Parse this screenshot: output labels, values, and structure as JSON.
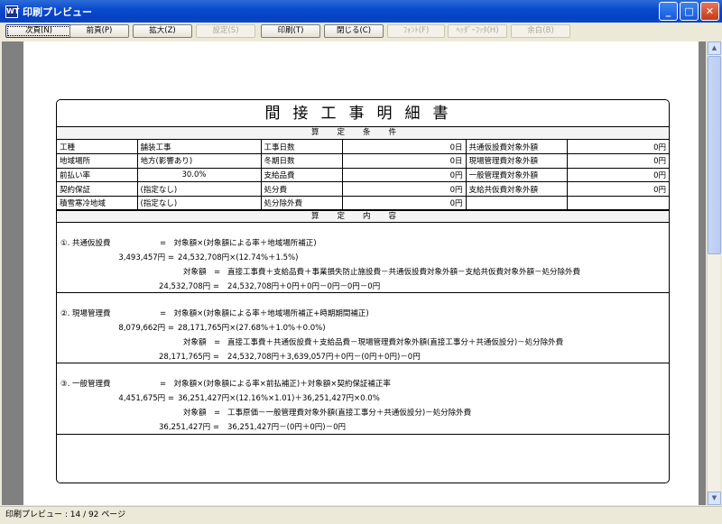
{
  "window": {
    "title": "印刷プレビュー",
    "app_icon": "WT"
  },
  "toolbar": {
    "next": "次頁(N)",
    "prev": "前頁(P)",
    "zoom": "拡大(Z)",
    "settings": "設定(S)",
    "print": "印刷(T)",
    "close": "閉じる(C)",
    "font": "ﾌｫﾝﾄ(F)",
    "header_footer": "ﾍｯﾀﾞｰﾌｯﾀ(H)",
    "margin": "余白(B)"
  },
  "status": "印刷プレビュー : 14 / 92 ページ",
  "doc": {
    "title": "間接工事明細書",
    "conditions_header": "算定条件",
    "contents_header": "算定内容",
    "conditions": [
      [
        "工種",
        "舗装工事",
        "工事日数",
        "0日",
        "共通仮設費対象外額",
        "0円"
      ],
      [
        "地域場所",
        "地方(影響あり)",
        "冬期日数",
        "0日",
        "現場管理費対象外額",
        "0円"
      ],
      [
        "前払い率",
        "30.0%",
        "支給品費",
        "0円",
        "一般管理費対象外額",
        "0円"
      ],
      [
        "契約保証",
        "(指定なし)",
        "処分費",
        "0円",
        "支給共仮費対象外額",
        "0円"
      ],
      [
        "積雪寒冷地域",
        "(指定なし)",
        "処分除外費",
        "0円",
        "",
        ""
      ]
    ],
    "calc": [
      {
        "label": "①. 共通仮設費",
        "amount": "3,493,457円 =",
        "f1": "=　対象額×(対象額による率＋地域場所補正)",
        "f2": "24,532,708円×(12.74%＋1.5%)",
        "t_label": "対象額　=",
        "t_formula": "直接工事費＋支給品費＋事業損失防止施設費－共通仮設費対象外額－支給共仮費対象外額－処分除外費",
        "t_amount": "24,532,708円 =",
        "t_values": "24,532,708円＋0円＋0円－0円－0円－0円"
      },
      {
        "label": "②. 現場管理費",
        "amount": "8,079,662円 =",
        "f1": "=　対象額×(対象額による率＋地域場所補正+時期期間補正)",
        "f2": "28,171,765円×(27.68%＋1.0%＋0.0%)",
        "t_label": "対象額　=",
        "t_formula": "直接工事費＋共通仮設費＋支給品費－現場管理費対象外額(直接工事分＋共通仮設分)－処分除外費",
        "t_amount": "28,171,765円 =",
        "t_values": "24,532,708円＋3,639,057円＋0円－(0円＋0円)－0円"
      },
      {
        "label": "③. 一般管理費",
        "amount": "4,451,675円 =",
        "f1": "=　対象額×(対象額による率×前払補正)＋対象額×契約保証補正率",
        "f2": "36,251,427円×(12.16%×1.01)＋36,251,427円×0.0%",
        "t_label": "対象額　=",
        "t_formula": "工事原価－一般管理費対象外額(直接工事分＋共通仮設分)－処分除外費",
        "t_amount": "36,251,427円 =",
        "t_values": "36,251,427円－(0円＋0円)－0円"
      }
    ]
  }
}
